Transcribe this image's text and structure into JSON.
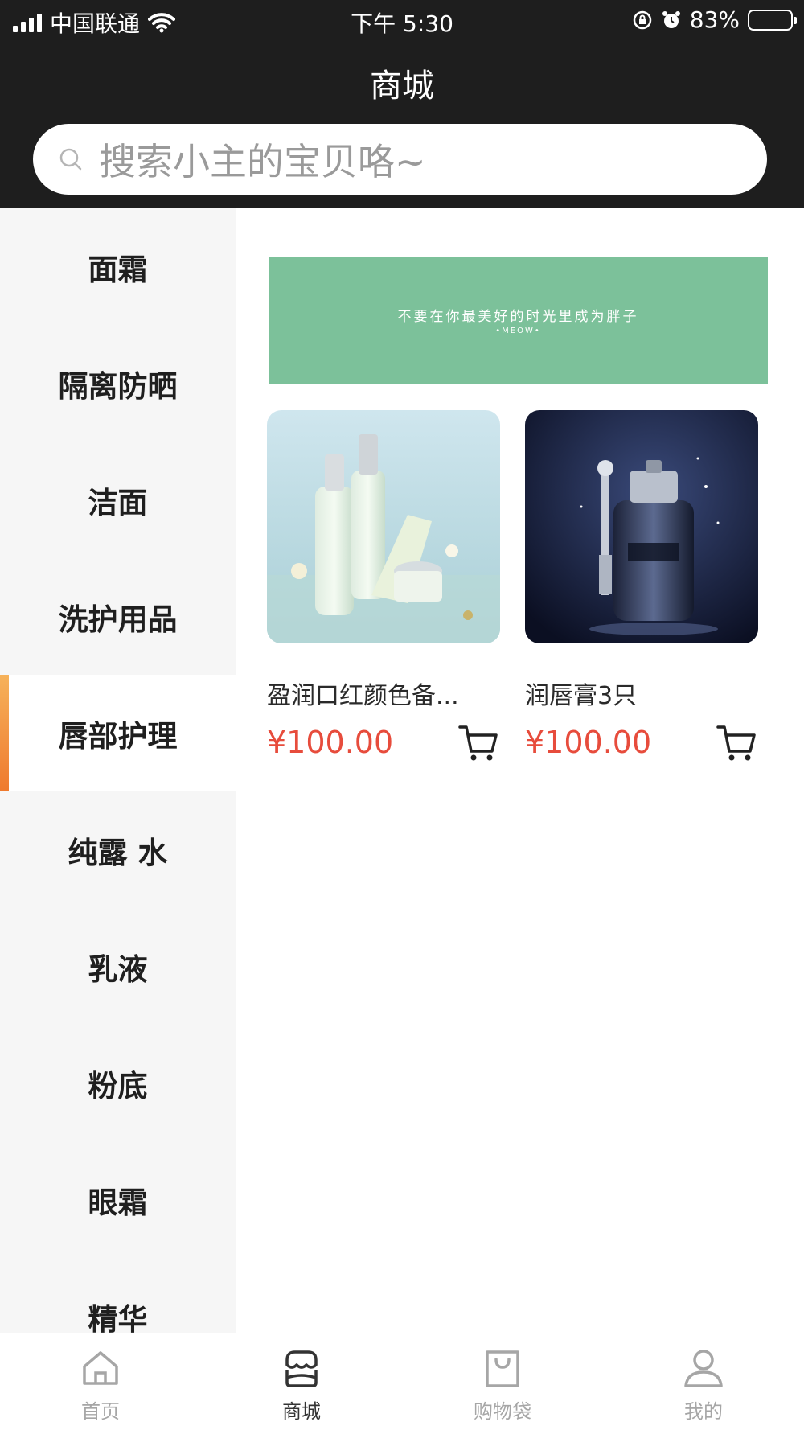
{
  "status_bar": {
    "carrier": "中国联通",
    "time": "下午 5:30",
    "battery": "83%",
    "battery_level": 0.83
  },
  "header": {
    "title": "商城",
    "search_placeholder": "搜索小主的宝贝咯~"
  },
  "sidebar": {
    "categories": [
      "面霜",
      "隔离防晒",
      "洁面",
      "洗护用品",
      "唇部护理",
      "纯露 水",
      "乳液",
      "粉底",
      "眼霜",
      "精华"
    ],
    "active": "唇部护理"
  },
  "banner": {
    "text": "不要在你最美好的时光里成为胖子",
    "subtext": "•MEOW•",
    "color": "#7cc19a"
  },
  "products": [
    {
      "name": "盈润口红颜色备...",
      "price": "¥100.00",
      "image_icon": "skincare-bottles-image"
    },
    {
      "name": "润唇膏3只",
      "price": "¥100.00",
      "image_icon": "lancome-serum-image"
    }
  ],
  "tabbar": {
    "items": [
      {
        "label": "首页",
        "icon": "home-icon"
      },
      {
        "label": "商城",
        "icon": "store-icon"
      },
      {
        "label": "购物袋",
        "icon": "bag-icon"
      },
      {
        "label": "我的",
        "icon": "user-icon"
      }
    ],
    "active": "商城"
  },
  "colors": {
    "header_bg": "#1e1e1e",
    "price": "#e74c3c",
    "accent": "#ef7a2e"
  }
}
